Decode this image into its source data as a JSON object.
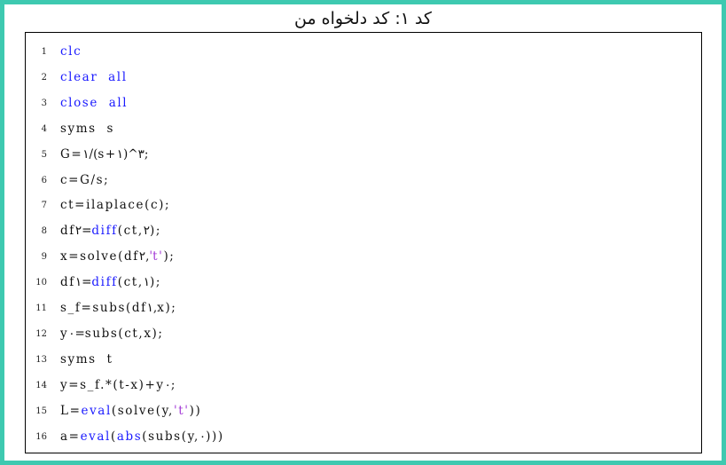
{
  "caption": "کد ۱: کد دلخواه من",
  "colors": {
    "frame": "#3ec9b0",
    "keyword": "#1a1aff",
    "string": "#a33ad6",
    "text": "#111111"
  },
  "code_lines": [
    {
      "number": "1",
      "tokens": [
        {
          "t": "clc",
          "k": "kw"
        }
      ]
    },
    {
      "number": "2",
      "tokens": [
        {
          "t": "clear  all",
          "k": "kw"
        }
      ]
    },
    {
      "number": "3",
      "tokens": [
        {
          "t": "close  all",
          "k": "kw"
        }
      ]
    },
    {
      "number": "4",
      "tokens": [
        {
          "t": "syms  s",
          "k": ""
        }
      ]
    },
    {
      "number": "5",
      "tokens": [
        {
          "t": "G=۱/(s+۱)^۳;",
          "k": ""
        }
      ]
    },
    {
      "number": "6",
      "tokens": [
        {
          "t": "c=G/s;",
          "k": ""
        }
      ]
    },
    {
      "number": "7",
      "tokens": [
        {
          "t": "ct=ilaplace(c);",
          "k": ""
        }
      ]
    },
    {
      "number": "8",
      "tokens": [
        {
          "t": "df۲=",
          "k": ""
        },
        {
          "t": "diff",
          "k": "kw"
        },
        {
          "t": "(ct,۲);",
          "k": ""
        }
      ]
    },
    {
      "number": "9",
      "tokens": [
        {
          "t": "x=solve(df۲,",
          "k": ""
        },
        {
          "t": "'t'",
          "k": "str"
        },
        {
          "t": ");",
          "k": ""
        }
      ]
    },
    {
      "number": "10",
      "tokens": [
        {
          "t": "df۱=",
          "k": ""
        },
        {
          "t": "diff",
          "k": "kw"
        },
        {
          "t": "(ct,۱);",
          "k": ""
        }
      ]
    },
    {
      "number": "11",
      "tokens": [
        {
          "t": "s_f=subs(df۱,x);",
          "k": ""
        }
      ]
    },
    {
      "number": "12",
      "tokens": [
        {
          "t": "y۰=subs(ct,x);",
          "k": ""
        }
      ]
    },
    {
      "number": "13",
      "tokens": [
        {
          "t": "syms  t",
          "k": ""
        }
      ]
    },
    {
      "number": "14",
      "tokens": [
        {
          "t": "y=s_f.*(t-x)+y۰;",
          "k": ""
        }
      ]
    },
    {
      "number": "15",
      "tokens": [
        {
          "t": "L=",
          "k": ""
        },
        {
          "t": "eval",
          "k": "kw"
        },
        {
          "t": "(solve(y,",
          "k": ""
        },
        {
          "t": "'t'",
          "k": "str"
        },
        {
          "t": "))",
          "k": ""
        }
      ]
    },
    {
      "number": "16",
      "tokens": [
        {
          "t": "a=",
          "k": ""
        },
        {
          "t": "eval",
          "k": "kw"
        },
        {
          "t": "(",
          "k": ""
        },
        {
          "t": "abs",
          "k": "kw"
        },
        {
          "t": "(subs(y,۰)))",
          "k": ""
        }
      ]
    }
  ]
}
